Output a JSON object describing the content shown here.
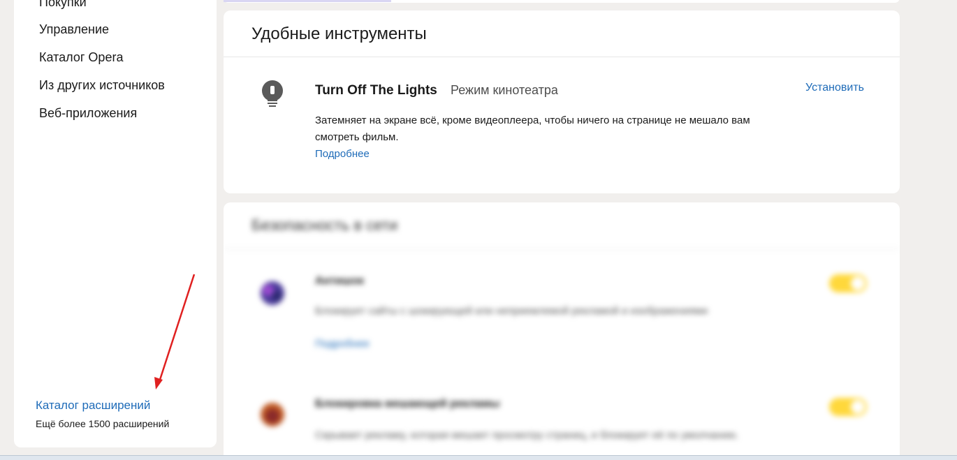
{
  "sidebar": {
    "items": [
      {
        "label": "Покупки"
      },
      {
        "label": "Управление"
      },
      {
        "label": "Каталог Opera"
      },
      {
        "label": "Из других источников"
      },
      {
        "label": "Веб-приложения"
      }
    ],
    "catalog_link": "Каталог расширений",
    "catalog_sub": "Ещё более 1500 расширений"
  },
  "tools_card": {
    "title": "Удобные инструменты",
    "extension": {
      "icon": "lightbulb-icon",
      "name": "Turn Off The Lights",
      "subtitle": "Режим кинотеатра",
      "description": "Затемняет на экране всё, кроме видеоплеера, чтобы ничего на странице не мешало вам смотреть фильм.",
      "more_link": "Подробнее",
      "install_label": "Установить"
    }
  },
  "security_card": {
    "title": "Безопасность в сети",
    "extensions": [
      {
        "icon": "antishock-icon",
        "name": "Антишок",
        "description": "Блокирует сайты с шокирующей или неприемлемой рекламой и изображениями",
        "more_link": "Подробнее",
        "enabled": true
      },
      {
        "icon": "notification-blocker-icon",
        "name": "Блокировка мешающей рекламы",
        "description": "Скрывает рекламу, которая мешает просмотру страниц, и блокирует её по умолчанию.",
        "enabled": true
      }
    ]
  },
  "colors": {
    "accent_link": "#1e6bb8",
    "toggle_on": "#ffd83b",
    "annotation_arrow": "#e02020"
  }
}
